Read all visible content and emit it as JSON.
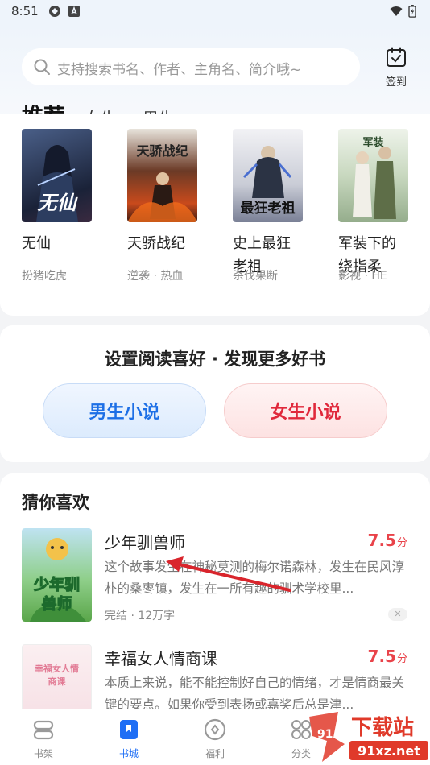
{
  "status_bar": {
    "time": "8:51"
  },
  "search": {
    "placeholder": "支持搜索书名、作者、主角名、简介哦~"
  },
  "signin": {
    "label": "签到"
  },
  "tabs": [
    {
      "label": "推荐",
      "active": true
    },
    {
      "label": "女生",
      "active": false
    },
    {
      "label": "男生",
      "active": false
    }
  ],
  "recommended": [
    {
      "title": "无仙",
      "tag": "扮猪吃虎",
      "cover_text": "无仙",
      "cover_color": "#2a3550"
    },
    {
      "title": "天骄战纪",
      "tag": "逆袭 · 热血",
      "cover_text": "天骄战纪",
      "cover_color": "#5a2a1e"
    },
    {
      "title": "史上最狂老祖",
      "tag": "杀伐果断",
      "cover_text": "最狂老祖",
      "cover_color": "#d9d9de"
    },
    {
      "title": "军装下的绕指柔",
      "tag": "影视 · HE",
      "cover_text": "军装",
      "cover_color": "#a9c4a0"
    }
  ],
  "preference": {
    "title": "设置阅读喜好 · 发现更多好书",
    "male_label": "男生小说",
    "female_label": "女生小说"
  },
  "guess": {
    "title": "猜你喜欢",
    "items": [
      {
        "title": "少年驯兽师",
        "score": "7.5",
        "score_unit": "分",
        "desc": "这个故事发生在神秘莫测的梅尔诺森林，发生在民风淳朴的桑枣镇，发生在一所有趣的驯术学校里...",
        "meta": "完结 · 12万字",
        "cover_text": "少年驯兽师"
      },
      {
        "title": "幸福女人情商课",
        "score": "7.5",
        "score_unit": "分",
        "desc": "本质上来说，能不能控制好自己的情绪，才是情商最关键的要点。如果你受到表扬或嘉奖后总是津...",
        "meta": "",
        "cover_text": "幸福女人情商课"
      }
    ]
  },
  "bottom_nav": [
    {
      "label": "书架",
      "icon": "bookshelf-icon",
      "active": false
    },
    {
      "label": "书城",
      "icon": "bookstore-icon",
      "active": true
    },
    {
      "label": "福利",
      "icon": "welfare-icon",
      "active": false
    },
    {
      "label": "分类",
      "icon": "category-icon",
      "active": false
    }
  ],
  "watermark": {
    "brand": "下载站",
    "domain": "91xz.net",
    "logo_glyph": "91"
  },
  "colors": {
    "accent": "#1e6ef5",
    "score": "#e9434a",
    "female": "#e0283b",
    "male": "#1d6fe6"
  }
}
